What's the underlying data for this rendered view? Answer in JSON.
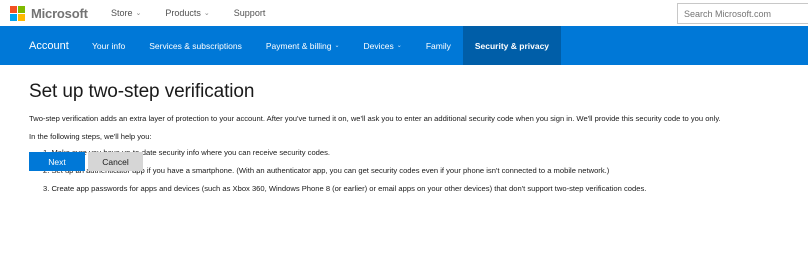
{
  "header": {
    "brand": "Microsoft",
    "nav": [
      {
        "label": "Store"
      },
      {
        "label": "Products"
      },
      {
        "label": "Support"
      }
    ],
    "search_placeholder": "Search Microsoft.com"
  },
  "account_nav": {
    "title": "Account",
    "items": [
      {
        "label": "Your info"
      },
      {
        "label": "Services & subscriptions"
      },
      {
        "label": "Payment & billing"
      },
      {
        "label": "Devices"
      },
      {
        "label": "Family"
      },
      {
        "label": "Security & privacy"
      }
    ],
    "active": "Security & privacy"
  },
  "main": {
    "title": "Set up two-step verification",
    "intro": "Two-step verification adds an extra layer of protection to your account. After you've turned it on, we'll ask you to enter an additional security code when you sign in. We'll provide this security code to you only.",
    "steps_intro": "In the following steps, we'll help you:",
    "steps": [
      "1. Make sure you have up-to-date security info where you can receive security codes.",
      "2. Set up an authenticator app if you have a smartphone. (With an authenticator app, you can get security codes even if your phone isn't connected to a mobile network.)",
      "3. Create app passwords for apps and devices (such as Xbox 360, Windows Phone 8 (or earlier) or email apps on your other devices) that don't support two-step verification codes."
    ],
    "next_label": "Next",
    "cancel_label": "Cancel"
  },
  "colors": {
    "accent": "#0078d7",
    "accent_active": "#005ea8",
    "cancel_bg": "#d6d6d6"
  },
  "icons": [
    "microsoft-logo",
    "chevron-down-icon"
  ]
}
